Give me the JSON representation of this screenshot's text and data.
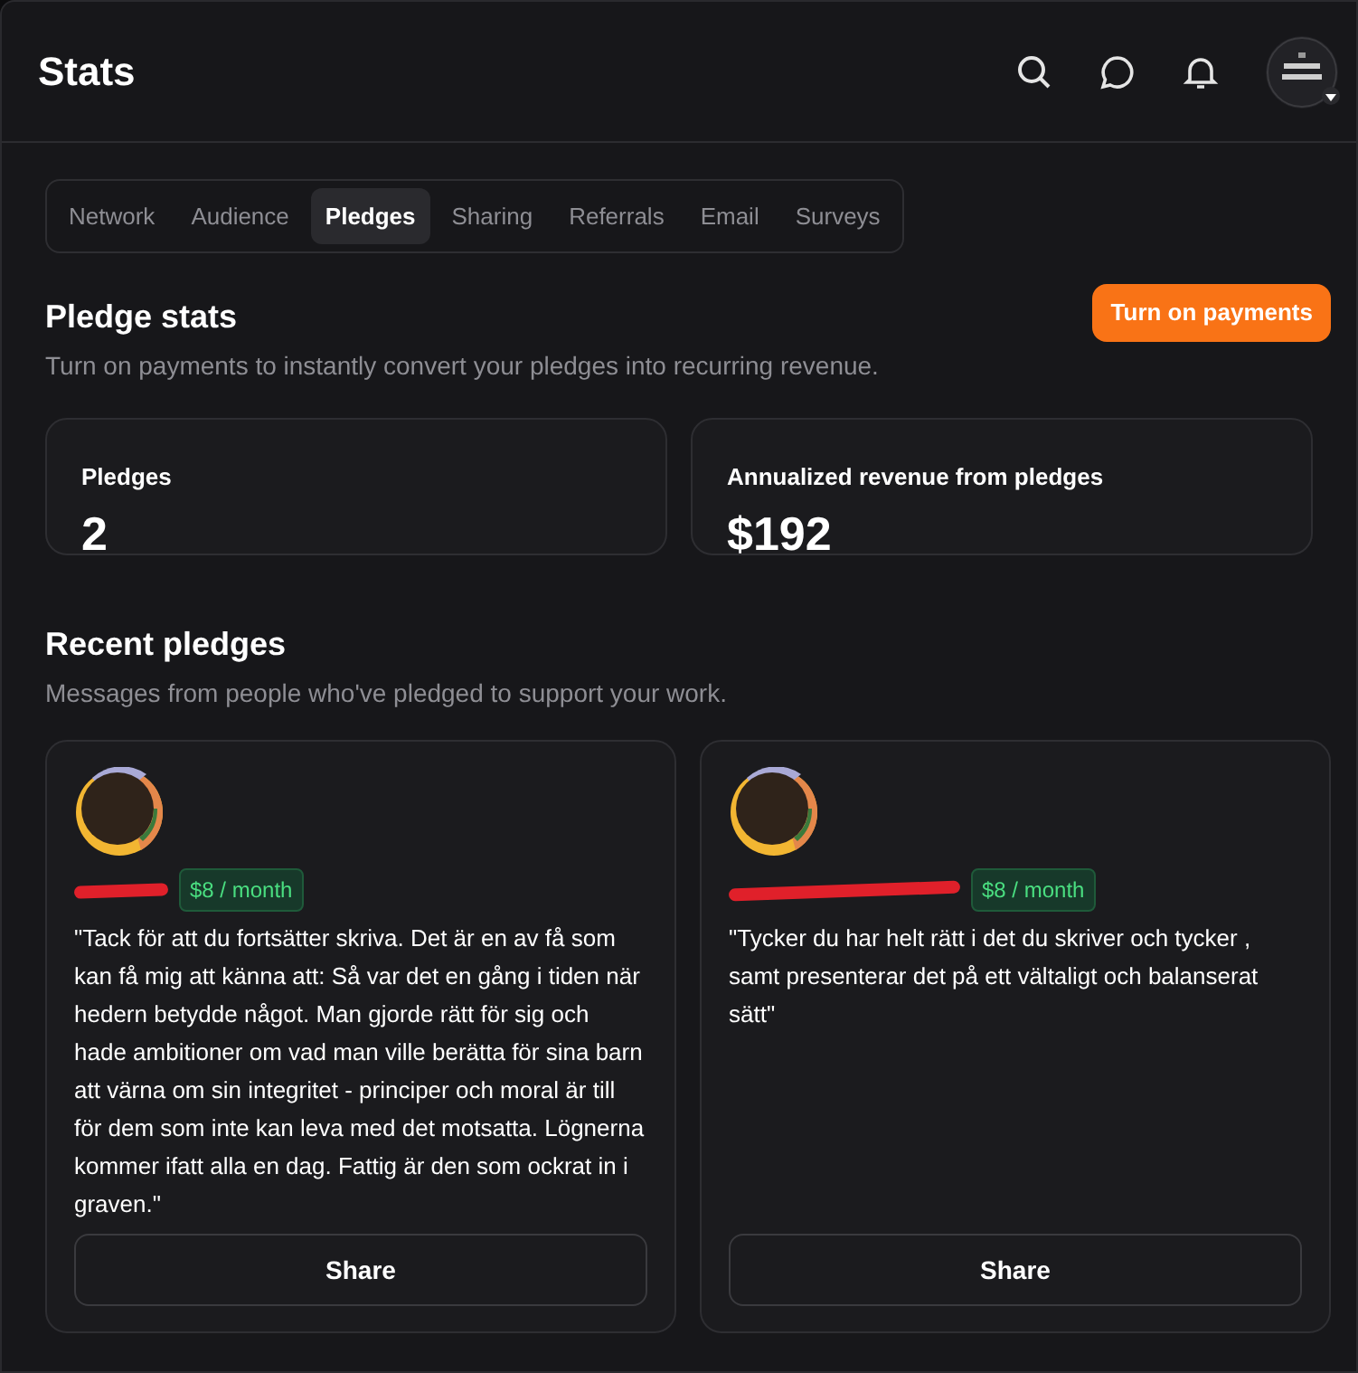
{
  "header": {
    "title": "Stats"
  },
  "tabs": [
    {
      "label": "Network",
      "selected": false
    },
    {
      "label": "Audience",
      "selected": false
    },
    {
      "label": "Pledges",
      "selected": true
    },
    {
      "label": "Sharing",
      "selected": false
    },
    {
      "label": "Referrals",
      "selected": false
    },
    {
      "label": "Email",
      "selected": false
    },
    {
      "label": "Surveys",
      "selected": false
    }
  ],
  "pledge_stats": {
    "title": "Pledge stats",
    "subtitle": "Turn on payments to instantly convert your pledges into recurring revenue.",
    "button": "Turn on payments"
  },
  "stat_cards": [
    {
      "label": "Pledges",
      "value": "2"
    },
    {
      "label": "Annualized revenue from pledges",
      "value": "$192"
    }
  ],
  "recent": {
    "title": "Recent pledges",
    "subtitle": "Messages from people who've pledged to support your work."
  },
  "pledges": [
    {
      "amount": "$8 / month",
      "message": "\"Tack för att du fortsätter skriva. Det är en av få som kan få mig att känna att: Så var det en gång i tiden när hedern betydde något. Man gjorde rätt för sig och hade ambitioner om vad man ville berätta för sina barn att värna om sin integritet - principer och moral är till för dem som inte kan leva med det motsatta. Lögnerna kommer ifatt alla en dag. Fattig är den som ockrat in i graven.\"",
      "button": "Share"
    },
    {
      "amount": "$8 / month",
      "message": "\"Tycker du har helt rätt i det du skriver och tycker , samt presenterar det på ett vältaligt och balanserat sätt\"",
      "button": "Share"
    }
  ]
}
